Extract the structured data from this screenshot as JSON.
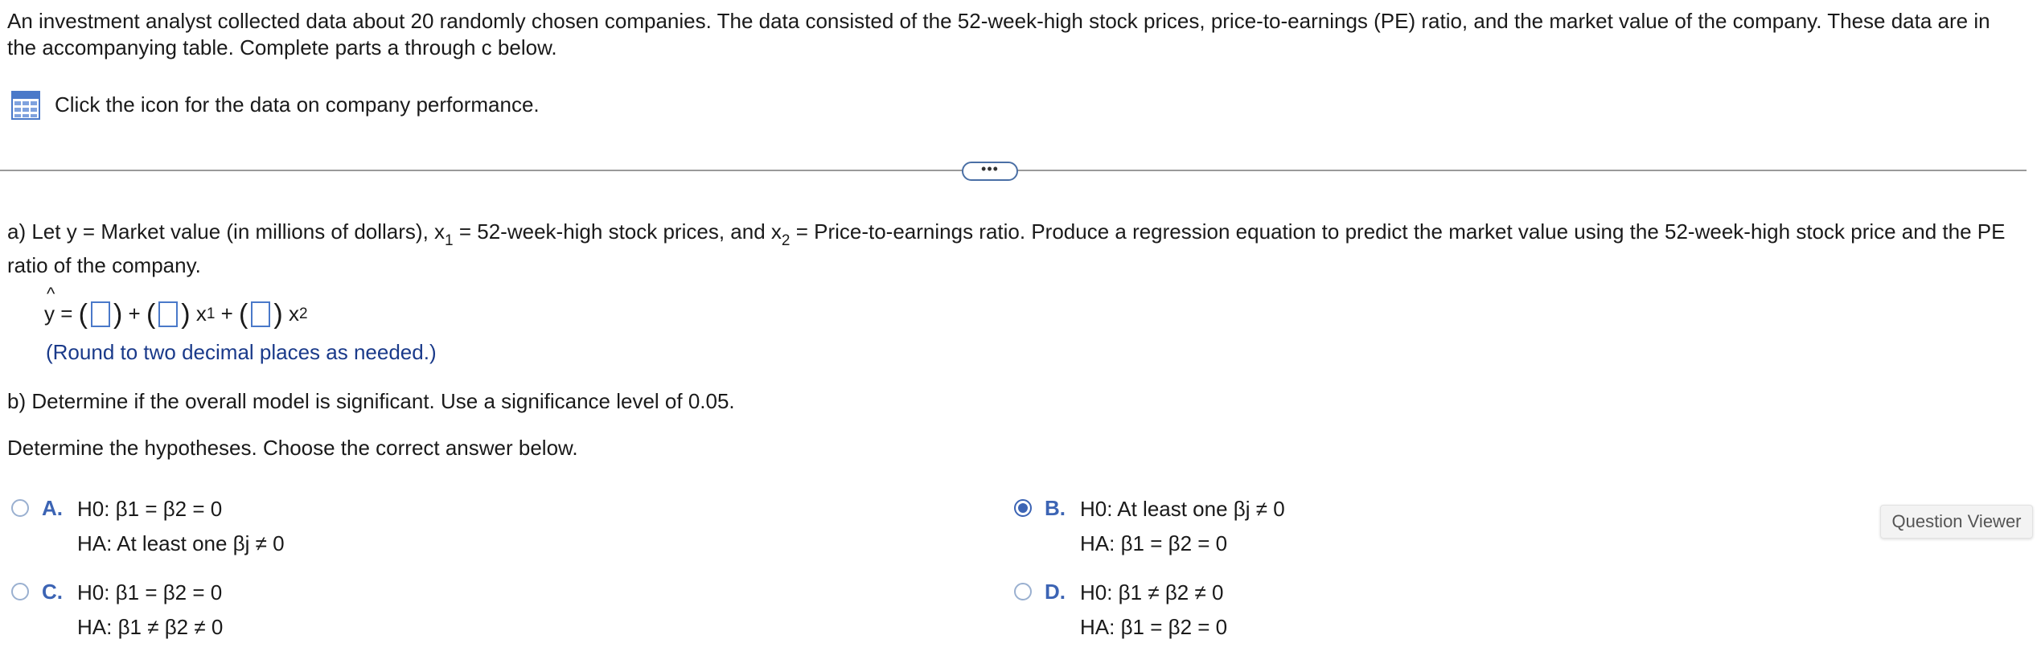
{
  "intro_text": "An investment analyst collected data about 20 randomly chosen companies. The data consisted of the 52-week-high stock prices, price-to-earnings (PE) ratio, and the market value of the company. These data are in the accompanying table. Complete parts a through c below.",
  "data_link": {
    "label": "Click the icon for the data on company performance.",
    "icon": "table-grid-icon"
  },
  "divider_handle": "•••",
  "part_a": {
    "text_1": "a) Let y = Market value (in millions of dollars), x",
    "sub_1": "1",
    "text_2": " = 52-week-high stock prices, and x",
    "sub_2": "2",
    "text_3": " = Price-to-earnings ratio. Produce a regression equation to predict the market value using the 52-week-high stock price and the PE ratio of the company."
  },
  "equation": {
    "y": "y",
    "hat": "^",
    "equals": " = ",
    "plus": " + ",
    "x": "x",
    "sub_1": "1",
    "sub_2": "2",
    "open_paren": "(",
    "close_paren": ")"
  },
  "round_note": "(Round to two decimal places as needed.)",
  "part_b": "b) Determine if the overall model is significant. Use a significance level of 0.05.",
  "hyp_prompt": "Determine the hypotheses. Choose the correct answer below.",
  "choices": [
    {
      "letter": "A.",
      "h0": "H0: β1 = β2 = 0",
      "ha": "HA: At least one βj ≠ 0",
      "selected": false
    },
    {
      "letter": "B.",
      "h0": "H0: At least one βj ≠ 0",
      "ha": "HA: β1 = β2 = 0",
      "selected": true
    },
    {
      "letter": "C.",
      "h0": "H0: β1 = β2 = 0",
      "ha": "HA: β1 ≠ β2 ≠ 0",
      "selected": false
    },
    {
      "letter": "D.",
      "h0": "H0: β1 ≠ β2 ≠ 0",
      "ha": "HA: β1 = β2 = 0",
      "selected": false
    }
  ],
  "question_viewer": "Question Viewer",
  "colors": {
    "accent": "#3c64b4",
    "note": "#1a3a8a",
    "box_border": "#4a79c9"
  }
}
